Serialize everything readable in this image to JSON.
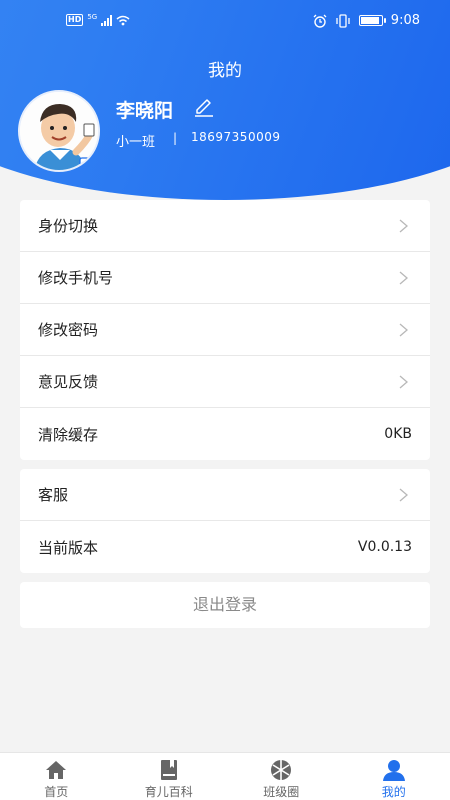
{
  "status": {
    "network": "HD",
    "signal_type": "5G",
    "time": "9:08"
  },
  "header": {
    "title": "我的"
  },
  "user": {
    "name": "李晓阳",
    "class_name": "小一班",
    "separator": "|",
    "phone": "18697350009"
  },
  "menu_group1": [
    {
      "label": "身份切换",
      "value": ""
    },
    {
      "label": "修改手机号",
      "value": ""
    },
    {
      "label": "修改密码",
      "value": ""
    },
    {
      "label": "意见反馈",
      "value": ""
    },
    {
      "label": "清除缓存",
      "value": "0KB"
    }
  ],
  "menu_group2": [
    {
      "label": "客服",
      "value": ""
    },
    {
      "label": "当前版本",
      "value": "V0.0.13"
    }
  ],
  "logout_label": "退出登录",
  "tabbar": {
    "items": [
      {
        "label": "首页",
        "icon": "home-icon"
      },
      {
        "label": "育儿百科",
        "icon": "book-icon"
      },
      {
        "label": "班级圈",
        "icon": "circle-icon"
      },
      {
        "label": "我的",
        "icon": "profile-icon"
      }
    ],
    "active_index": 3
  },
  "colors": {
    "primary": "#2270ec",
    "header_gradient_start": "#3f8ef5",
    "header_gradient_end": "#1a63ec"
  }
}
